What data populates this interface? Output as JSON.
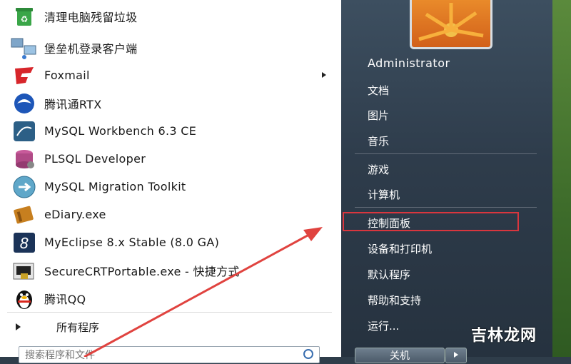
{
  "programs": [
    {
      "label": "清理电脑残留垃圾",
      "icon": "recycle-bin-icon"
    },
    {
      "label": "堡垒机登录客户端",
      "icon": "network-computers-icon"
    },
    {
      "label": "Foxmail",
      "icon": "foxmail-icon",
      "has_submenu": true
    },
    {
      "label": "腾讯通RTX",
      "icon": "rtx-icon"
    },
    {
      "label": "MySQL Workbench 6.3 CE",
      "icon": "mysql-workbench-icon"
    },
    {
      "label": "PLSQL Developer",
      "icon": "plsql-developer-icon"
    },
    {
      "label": "MySQL Migration Toolkit",
      "icon": "mysql-migration-icon"
    },
    {
      "label": "eDiary.exe",
      "icon": "diary-book-icon"
    },
    {
      "label": "MyEclipse 8.x Stable (8.0 GA)",
      "icon": "myeclipse-icon"
    },
    {
      "label": "SecureCRTPortable.exe - 快捷方式",
      "icon": "securecrt-icon"
    },
    {
      "label": "腾讯QQ",
      "icon": "qq-penguin-icon"
    }
  ],
  "all_programs": "所有程序",
  "search": {
    "placeholder": "搜索程序和文件"
  },
  "user": {
    "name": "Administrator"
  },
  "right_items": {
    "documents": "文档",
    "pictures": "图片",
    "music": "音乐",
    "games": "游戏",
    "computer": "计算机",
    "control_panel": "控制面板",
    "devices_printers": "设备和打印机",
    "default_programs": "默认程序",
    "help_support": "帮助和支持",
    "run": "运行..."
  },
  "shutdown_label": "关机",
  "watermark": "吉林龙网",
  "colors": {
    "highlight": "#d9363e",
    "annotation_arrow": "#e0433f"
  }
}
